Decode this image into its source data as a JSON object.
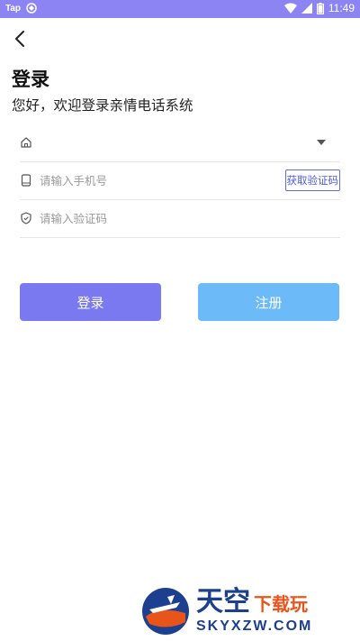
{
  "status_bar": {
    "carrier": "Tap",
    "time": "11:49",
    "background_color": "#8c84f3"
  },
  "header": {
    "back_icon": "chevron-left-icon"
  },
  "login": {
    "title": "登录",
    "subtitle": "您好，欢迎登录亲情电话系统"
  },
  "form": {
    "school_select": {
      "icon": "home-icon",
      "value": ""
    },
    "phone": {
      "icon": "phone-icon",
      "placeholder": "请输入手机号",
      "value": ""
    },
    "code": {
      "icon": "shield-icon",
      "placeholder": "请输入验证码",
      "value": "",
      "get_code_label": "获取验证码"
    }
  },
  "buttons": {
    "login_label": "登录",
    "register_label": "注册",
    "login_color": "#7b79f0",
    "register_color": "#6cbaf8"
  },
  "watermark": {
    "line1_a": "天空",
    "line1_b": "下载玩",
    "line2": "SKYXZW.COM"
  }
}
